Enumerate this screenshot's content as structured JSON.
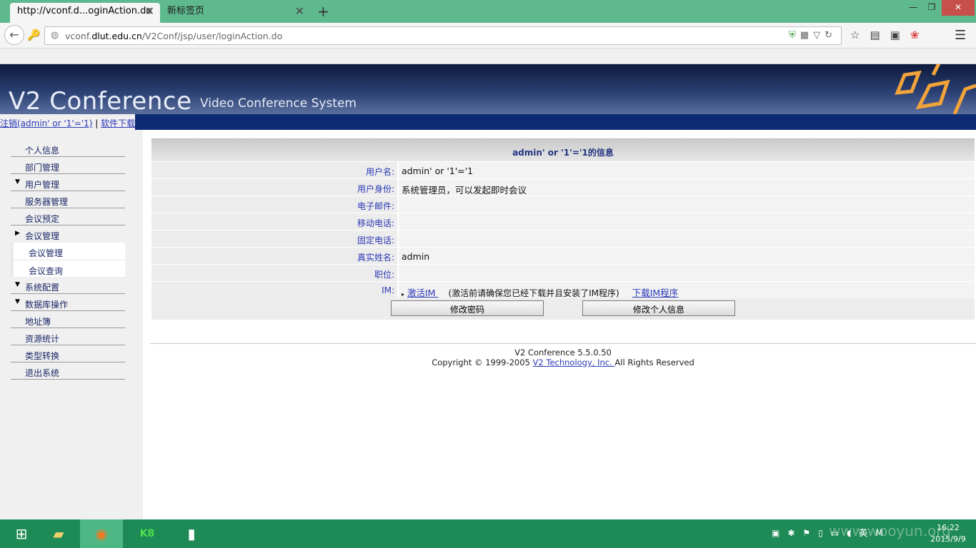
{
  "browser": {
    "tabs": [
      {
        "label": "http://vconf.d...oginAction.do"
      },
      {
        "label": "新标签页"
      }
    ],
    "url_host_prefix": "vconf.",
    "url_host_main": "dlut.edu.cn",
    "url_path": "/V2Conf/jsp/user/loginAction.do"
  },
  "banner": {
    "logo": "V2 Conference",
    "subtitle": "Video Conference System"
  },
  "userlinks": {
    "logout": "注销(admin' or '1'='1)",
    "separator": " | ",
    "download": "软件下载"
  },
  "sidebar": {
    "items": [
      {
        "label": "个人信息",
        "arrow": ""
      },
      {
        "label": "部门管理",
        "arrow": ""
      },
      {
        "label": "用户管理",
        "arrow": "▼"
      },
      {
        "label": "服务器管理",
        "arrow": ""
      },
      {
        "label": "会议预定",
        "arrow": ""
      },
      {
        "label": "会议管理",
        "arrow": "▶"
      },
      {
        "label": "会议管理",
        "arrow": ""
      },
      {
        "label": "会议查询",
        "arrow": ""
      },
      {
        "label": "系统配置",
        "arrow": "▼"
      },
      {
        "label": "数据库操作",
        "arrow": "▼"
      },
      {
        "label": "地址簿",
        "arrow": ""
      },
      {
        "label": "资源统计",
        "arrow": ""
      },
      {
        "label": "类型转换",
        "arrow": ""
      },
      {
        "label": "退出系统",
        "arrow": ""
      }
    ]
  },
  "info": {
    "title": "admin' or '1'='1的信息",
    "rows": [
      {
        "label": "用户名:",
        "value": "admin' or '1'='1"
      },
      {
        "label": "用户身份:",
        "value": "系统管理员，可以发起即时会议"
      },
      {
        "label": "电子邮件:",
        "value": ""
      },
      {
        "label": "移动电话:",
        "value": ""
      },
      {
        "label": "固定电话:",
        "value": ""
      },
      {
        "label": "真实姓名:",
        "value": "admin"
      },
      {
        "label": "职位:",
        "value": ""
      }
    ],
    "im_label": "IM:",
    "im_bullet": "▸",
    "im_activate": "激活IM ",
    "im_note": "(激活前请确保您已经下载并且安装了IM程序)",
    "im_download": "下载IM程序",
    "btn_change_password": "修改密码",
    "btn_edit_info": "修改个人信息"
  },
  "footer": {
    "version": "V2 Conference 5.5.0.50",
    "copyright_prefix": "Copyright © 1999-2005 ",
    "company": "V2 Technology, Inc. ",
    "rights": "All Rights Reserved"
  },
  "taskbar": {
    "clock_time": "16:22",
    "clock_date": "2015/9/9",
    "tray_lang": "英",
    "watermark": "www.wooyun.org"
  }
}
